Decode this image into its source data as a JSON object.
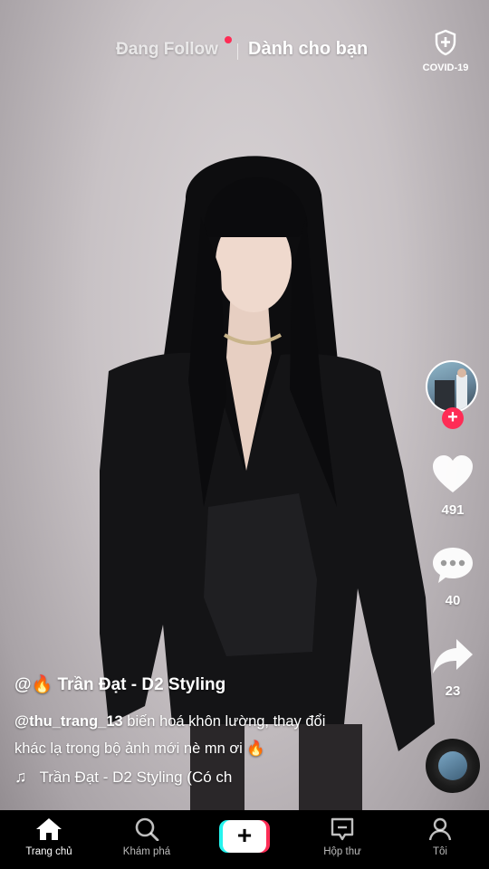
{
  "top_bar": {
    "following_tab": "Đang Follow",
    "for_you_tab": "Dành cho bạn",
    "covid_label": "COVID-19"
  },
  "actions": {
    "likes": "491",
    "comments": "40",
    "shares": "23"
  },
  "caption": {
    "author": "@🔥 Trần Đạt - D2 Styling",
    "mention": "@thu_trang_13",
    "text_line1": " biến hoá khôn lường, thay đổi",
    "text_line2": "khác lạ trong bộ ảnh mới nè mn ơi 🔥",
    "music": "Trần Đạt - D2 Styling (Có ch"
  },
  "nav": {
    "home": "Trang chủ",
    "discover": "Khám phá",
    "inbox": "Hộp thư",
    "me": "Tôi"
  },
  "colors": {
    "accent": "#fe2c55",
    "cyan": "#25f4ee"
  }
}
